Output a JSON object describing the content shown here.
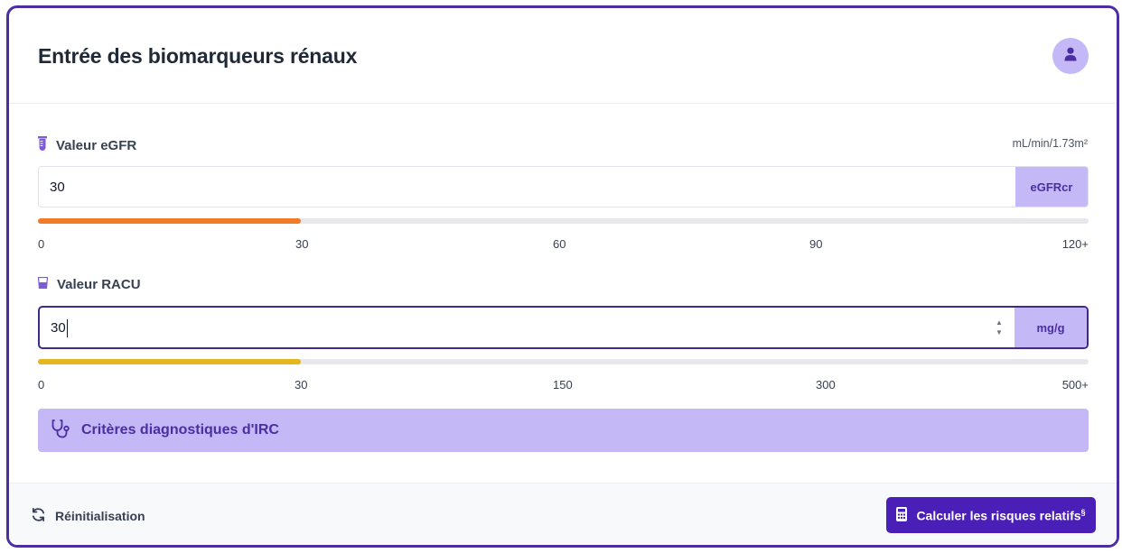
{
  "header": {
    "title": "Entrée des biomarqueurs rénaux",
    "avatar_icon": "user-icon"
  },
  "egfr": {
    "label": "Valeur eGFR",
    "icon": "test-tube-icon",
    "unit": "mL/min/1.73m²",
    "value": "30",
    "addon": "eGFRcr",
    "bar_fill_fraction": 0.25,
    "bar_color": "#f07c2a",
    "ticks": [
      "0",
      "30",
      "60",
      "90",
      "120+"
    ]
  },
  "racu": {
    "label": "Valeur RACU",
    "icon": "urine-cup-icon",
    "value": "30",
    "addon": "mg/g",
    "bar_fill_fraction": 0.25,
    "bar_color": "#e4b61f",
    "ticks": [
      "0",
      "30",
      "150",
      "300",
      "500+"
    ]
  },
  "criteria": {
    "label": "Critères diagnostiques d'IRC",
    "icon": "stethoscope-icon"
  },
  "footer": {
    "reset_label": "Réinitialisation",
    "reset_icon": "refresh-icon",
    "calc_label": "Calculer les risques relatifs",
    "calc_sup": "§",
    "calc_icon": "calculator-icon"
  },
  "colors": {
    "accent": "#4a1fb8",
    "accent_light": "#c4b8f6",
    "border": "#4c2ea3"
  }
}
